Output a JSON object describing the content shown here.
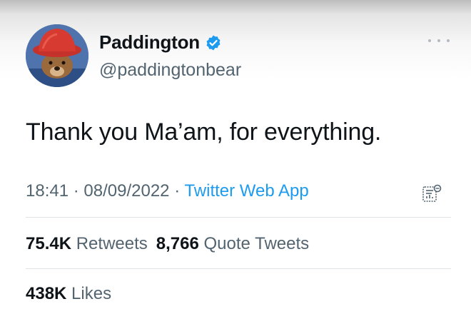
{
  "user": {
    "display_name": "Paddington",
    "handle": "@paddingtonbear",
    "verified": true,
    "avatar_icon": "paddington-bear-avatar"
  },
  "tweet": {
    "text": "Thank you Ma’am, for everything.",
    "time": "18:41",
    "date": "08/09/2022",
    "separator": "·",
    "source": "Twitter Web App"
  },
  "stats": {
    "retweets_count": "75.4K",
    "retweets_label": "Retweets",
    "quotes_count": "8,766",
    "quotes_label": "Quote Tweets",
    "likes_count": "438K",
    "likes_label": "Likes"
  },
  "icons": {
    "verified": "verified-badge-icon",
    "more": "more-options-icon",
    "analytics": "tweet-analytics-icon"
  },
  "colors": {
    "accent": "#1d9bf0",
    "text_primary": "#0f1419",
    "text_secondary": "#536471",
    "divider": "#dfe3e6"
  }
}
